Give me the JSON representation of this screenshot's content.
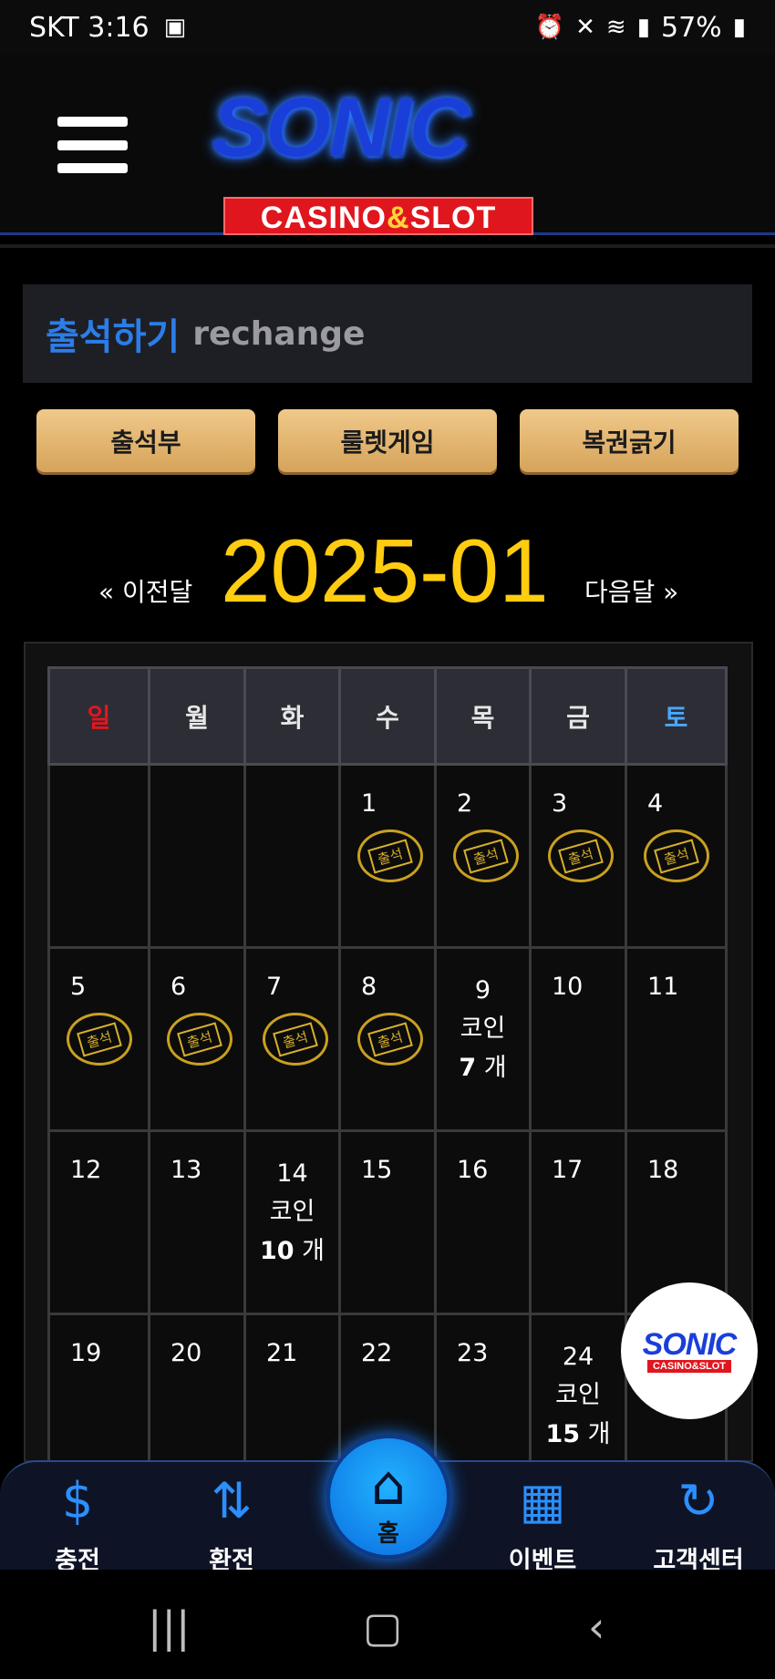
{
  "status_bar": {
    "carrier_time": "SKT 3:16",
    "battery": "57%",
    "icons": [
      "gallery-icon",
      "alarm-icon",
      "mute-icon",
      "wifi-icon",
      "signal-icon",
      "battery-icon"
    ]
  },
  "header": {
    "logo_top": "SONIC",
    "logo_bottom_a": "CASINO",
    "logo_bottom_amp": "&",
    "logo_bottom_b": "SLOT"
  },
  "page_title": {
    "ko": "출석하기",
    "en": "rechange"
  },
  "tabs": [
    "출석부",
    "룰렛게임",
    "복권긁기"
  ],
  "month_nav": {
    "prev": "« 이전달",
    "current": "2025-01",
    "next": "다음달 »"
  },
  "calendar": {
    "weekdays": [
      "일",
      "월",
      "화",
      "수",
      "목",
      "금",
      "토"
    ],
    "weekday_colors": {
      "sun": "#e0161e",
      "sat": "#4aa8ff"
    },
    "stamp_label": "출석",
    "coin_label": "코인",
    "coin_unit": "개",
    "weeks": [
      [
        "",
        "",
        "",
        "1",
        "2",
        "3",
        "4"
      ],
      [
        "5",
        "6",
        "7",
        "8",
        "9",
        "10",
        "11"
      ],
      [
        "12",
        "13",
        "14",
        "15",
        "16",
        "17",
        "18"
      ],
      [
        "19",
        "20",
        "21",
        "22",
        "23",
        "24",
        ""
      ]
    ],
    "stamped_days": [
      "1",
      "2",
      "3",
      "4",
      "5",
      "6",
      "7",
      "8"
    ],
    "coin_rewards": [
      {
        "day": "9",
        "count": "7"
      },
      {
        "day": "14",
        "count": "10"
      },
      {
        "day": "24",
        "count": "15"
      }
    ]
  },
  "float_logo": {
    "top": "SONIC",
    "bottom": "CASINO&SLOT"
  },
  "bottom_nav": {
    "items": [
      {
        "label": "충전",
        "icon": "deposit-icon"
      },
      {
        "label": "환전",
        "icon": "withdraw-icon"
      },
      {
        "label": "이벤트",
        "icon": "gift-icon"
      },
      {
        "label": "고객센터",
        "icon": "support-24-icon"
      }
    ],
    "home_label": "홈"
  },
  "colors": {
    "accent_blue": "#2b7de9",
    "month_yellow": "#ffcc10",
    "tab_gold": "#e3b872"
  }
}
